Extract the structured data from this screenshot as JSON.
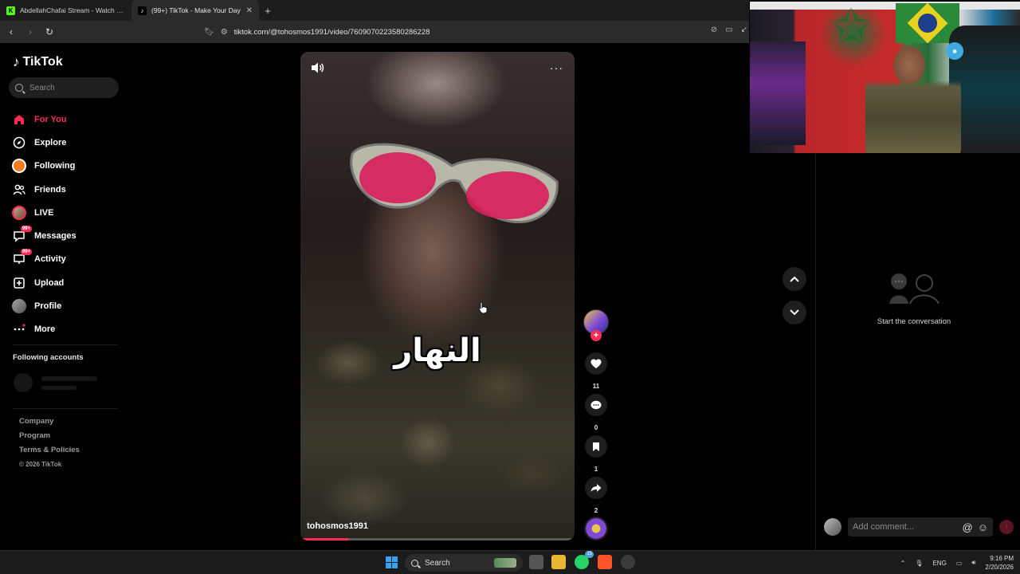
{
  "browser": {
    "tabs": [
      {
        "title": "AbdellahChafai Stream - Watch Live :",
        "active": false,
        "favicon": "kick-icon"
      },
      {
        "title": "(99+) TikTok - Make Your Day",
        "active": true,
        "favicon": "tiktok-icon"
      }
    ],
    "url": "tiktok.com/@tohosmos1991/video/7609070223580286228"
  },
  "sidebar": {
    "logo": "TikTok",
    "search_placeholder": "Search",
    "menu": [
      {
        "label": "For You",
        "icon": "home-icon",
        "active": true
      },
      {
        "label": "Explore",
        "icon": "compass-icon"
      },
      {
        "label": "Following",
        "icon": "following-avatar-icon"
      },
      {
        "label": "Friends",
        "icon": "friends-icon"
      },
      {
        "label": "LIVE",
        "icon": "live-avatar-icon"
      },
      {
        "label": "Messages",
        "icon": "messages-icon",
        "badge": "99+"
      },
      {
        "label": "Activity",
        "icon": "activity-icon",
        "badge": "99+"
      },
      {
        "label": "Upload",
        "icon": "upload-icon"
      },
      {
        "label": "Profile",
        "icon": "profile-avatar-icon"
      },
      {
        "label": "More",
        "icon": "more-icon"
      }
    ],
    "following_accounts_title": "Following accounts",
    "footer": {
      "company": "Company",
      "program": "Program",
      "terms": "Terms & Policies",
      "copyright": "© 2026 TikTok"
    }
  },
  "video": {
    "caption": "النهار",
    "username": "tohosmos1991",
    "progress": 0.17
  },
  "actions": {
    "likes": "11",
    "comments": "0",
    "saves": "1",
    "shares": "2"
  },
  "comments": {
    "empty_text": "Start the conversation",
    "placeholder": "Add comment..."
  },
  "taskbar": {
    "search_label": "Search",
    "language": "ENG",
    "time": "9:16 PM",
    "date": "2/20/2026",
    "whatsapp_badge": "15"
  },
  "colors": {
    "accent": "#fe2c55",
    "background": "#000000"
  }
}
